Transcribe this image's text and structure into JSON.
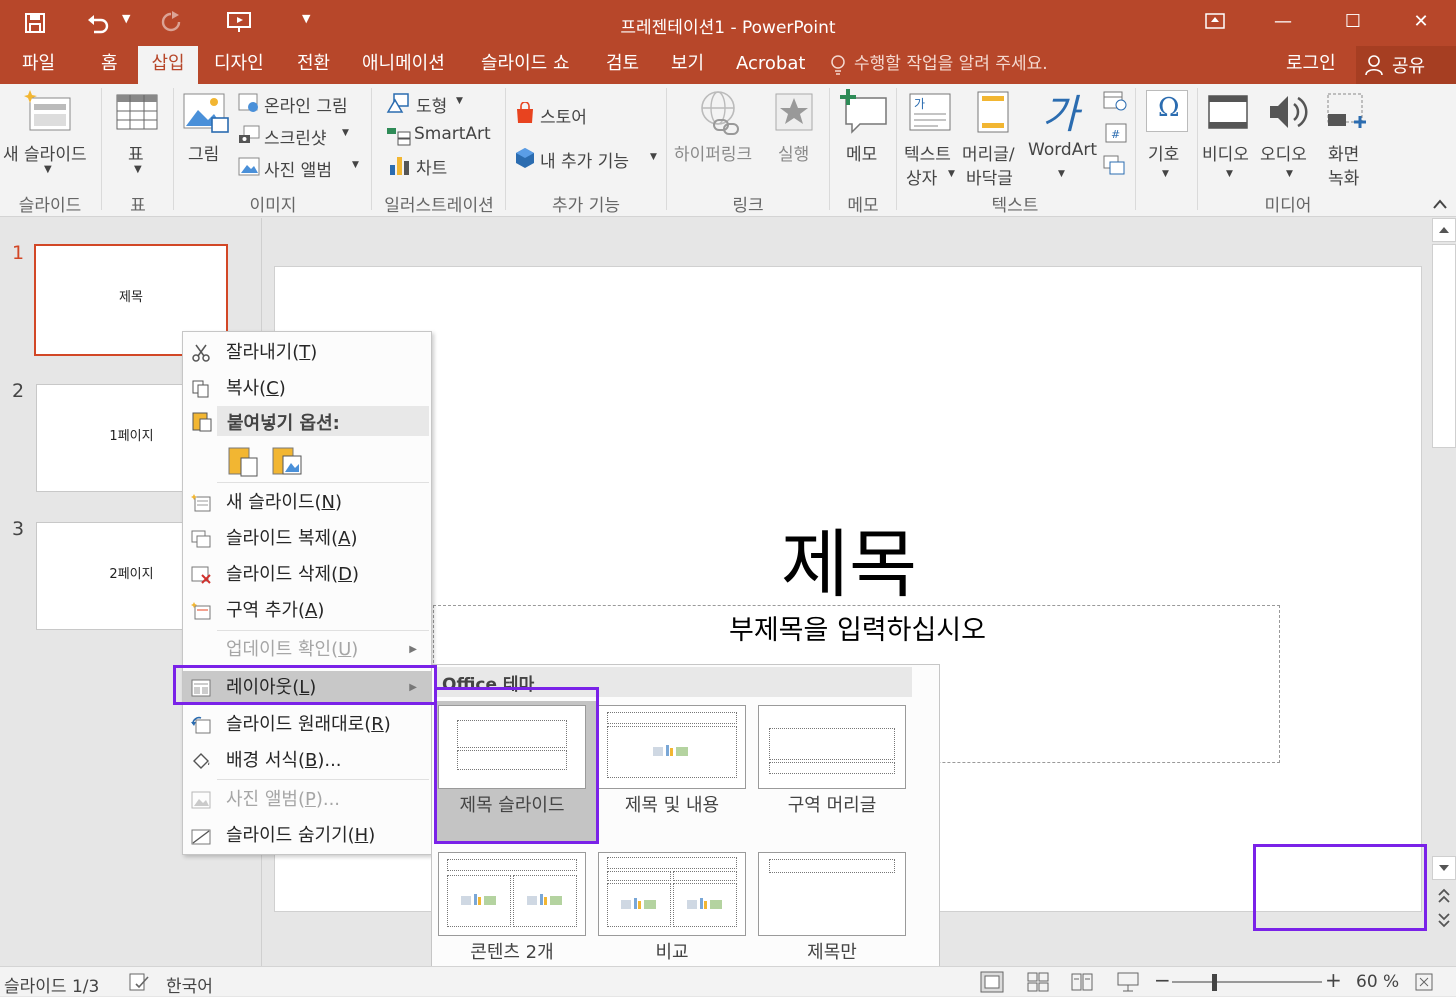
{
  "titlebar": {
    "title": "프레젠테이션1 - PowerPoint",
    "minimize": "—",
    "maximize": "☐",
    "close": "✕"
  },
  "tabs": {
    "file": "파일",
    "home": "홈",
    "insert": "삽입",
    "design": "디자인",
    "transitions": "전환",
    "animations": "애니메이션",
    "slideshow": "슬라이드 쇼",
    "review": "검토",
    "view": "보기",
    "acrobat": "Acrobat",
    "tell_me": "수행할 작업을 알려 주세요.",
    "signin": "로그인",
    "share": "공유"
  },
  "ribbon": {
    "new_slide": "새 슬라이드",
    "table": "표",
    "pictures": "그림",
    "online_pictures": "온라인 그림",
    "screenshot": "스크린샷",
    "photo_album": "사진 앨범",
    "shapes": "도형",
    "smartart": "SmartArt",
    "chart": "차트",
    "store": "스토어",
    "my_addins": "내 추가 기능",
    "hyperlink": "하이퍼링크",
    "action": "실행",
    "comment": "메모",
    "textbox_1": "텍스트",
    "textbox_2": "상자",
    "header_footer_1": "머리글/",
    "header_footer_2": "바닥글",
    "wordart": "WordArt",
    "symbols": "기호",
    "video": "비디오",
    "audio": "오디오",
    "screen_rec_1": "화면",
    "screen_rec_2": "녹화",
    "groups": {
      "slides": "슬라이드",
      "tables": "표",
      "images": "이미지",
      "illustrations": "일러스트레이션",
      "addins": "추가 기능",
      "links": "링크",
      "comments": "메모",
      "text": "텍스트",
      "media": "미디어"
    }
  },
  "slides": [
    {
      "num": "1",
      "text": "제목"
    },
    {
      "num": "2",
      "text": "1페이지"
    },
    {
      "num": "3",
      "text": "2페이지"
    }
  ],
  "slide": {
    "title": "제목",
    "subtitle": "부제목을 입력하십시오"
  },
  "context_menu": {
    "cut": "잘라내기(",
    "cut_key": "T",
    "copy": "복사(",
    "copy_key": "C",
    "paste_options": "붙여넣기 옵션:",
    "new_slide": "새 슬라이드(",
    "new_slide_key": "N",
    "duplicate": "슬라이드 복제(",
    "duplicate_key": "A",
    "delete": "슬라이드 삭제(",
    "delete_key": "D",
    "add_section": "구역 추가(",
    "add_section_key": "A",
    "check_updates": "업데이트 확인(",
    "check_updates_key": "U",
    "layout": "레이아웃(",
    "layout_key": "L",
    "reset": "슬라이드 원래대로(",
    "reset_key": "R",
    "format_bg": "배경 서식(",
    "format_bg_key": "B",
    "format_bg_tail": ")...",
    "photo_album": "사진 앨범(",
    "photo_album_key": "P",
    "photo_album_tail": ")...",
    "hide": "슬라이드 숨기기(",
    "hide_key": "H",
    "close_paren": ")"
  },
  "layout_menu": {
    "header": "Office 테마",
    "layouts": [
      "제목 슬라이드",
      "제목 및 내용",
      "구역 머리글",
      "콘텐츠 2개",
      "비교",
      "제목만"
    ]
  },
  "status": {
    "slide_count": "슬라이드 1/3",
    "language": "한국어",
    "zoom": "60 %"
  },
  "colors": {
    "accent": "#b7472a",
    "highlight": "#7a22e8"
  }
}
